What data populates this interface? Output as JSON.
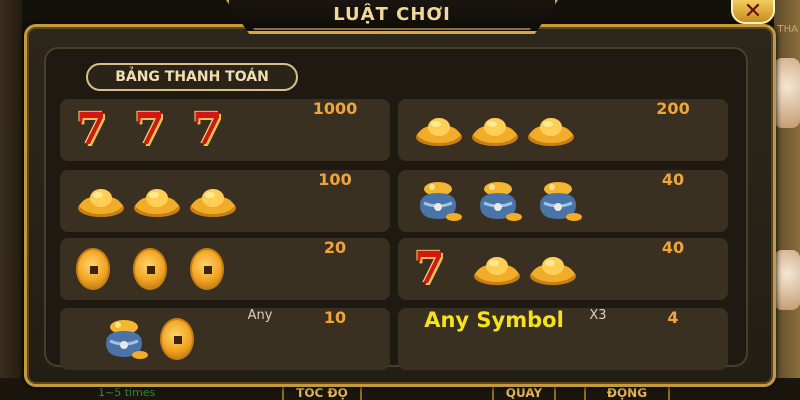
{
  "dialog": {
    "title": "LUẬT CHƠI",
    "close_icon": "close-x-icon",
    "section_label": "BẢNG THANH TOÁN"
  },
  "paytable": {
    "left": [
      {
        "symbols": [
          "seven",
          "seven",
          "seven"
        ],
        "mult": "",
        "payout": "1000"
      },
      {
        "symbols": [
          "ingot",
          "ingot",
          "ingot"
        ],
        "mult": "",
        "payout": "100"
      },
      {
        "symbols": [
          "coin",
          "coin",
          "coin"
        ],
        "mult": "",
        "payout": "20"
      },
      {
        "symbols": [
          "bag",
          "coin"
        ],
        "mult": "Any",
        "payout": "10"
      }
    ],
    "right": [
      {
        "symbols": [
          "ingot",
          "ingot",
          "ingot"
        ],
        "mult": "",
        "payout": "200"
      },
      {
        "symbols": [
          "bag",
          "bag",
          "bag"
        ],
        "mult": "",
        "payout": "40"
      },
      {
        "symbols": [
          "seven",
          "ingot",
          "ingot"
        ],
        "mult": "",
        "payout": "40"
      },
      {
        "any_symbol": "Any Symbol",
        "mult": "X3",
        "payout": "4"
      }
    ]
  },
  "background": {
    "times_text": "1~5 times",
    "buttons": [
      "TỐC ĐỘ",
      "QUAY",
      "ĐỘNG"
    ],
    "side_text": "THA"
  },
  "colors": {
    "frame_gold": "#c49a3c",
    "payout_orange": "#f0a53a",
    "any_symbol_yellow": "#f4e31a",
    "row_bg": "#3a3022"
  }
}
